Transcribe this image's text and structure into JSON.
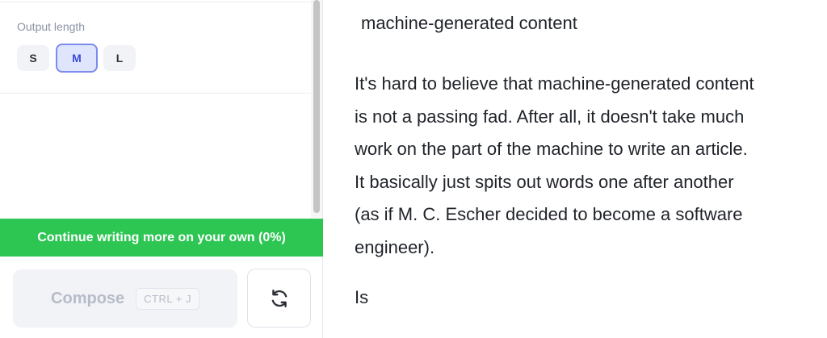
{
  "settings": {
    "output_length_label": "Output length",
    "length_options": [
      "S",
      "M",
      "L"
    ],
    "selected_length": "M"
  },
  "continue_bar": {
    "label": "Continue writing more on your own (0%)"
  },
  "compose": {
    "label": "Compose",
    "shortcut": "CTRL + J"
  },
  "icons": {
    "refresh": "refresh-icon"
  },
  "colors": {
    "accent_green": "#2dc653",
    "selected_blue": "#7d8bee"
  },
  "document": {
    "title": "machine-generated content",
    "paragraph_lines": [
      "It's hard to believe that machine-generated content",
      "is not a passing fad. After all, it doesn't take much",
      "work on the part of the machine to write an article.",
      "It basically just spits out words one after another",
      "(as if M. C. Escher decided to become a software",
      "engineer)."
    ],
    "next_paragraph": "Is"
  }
}
